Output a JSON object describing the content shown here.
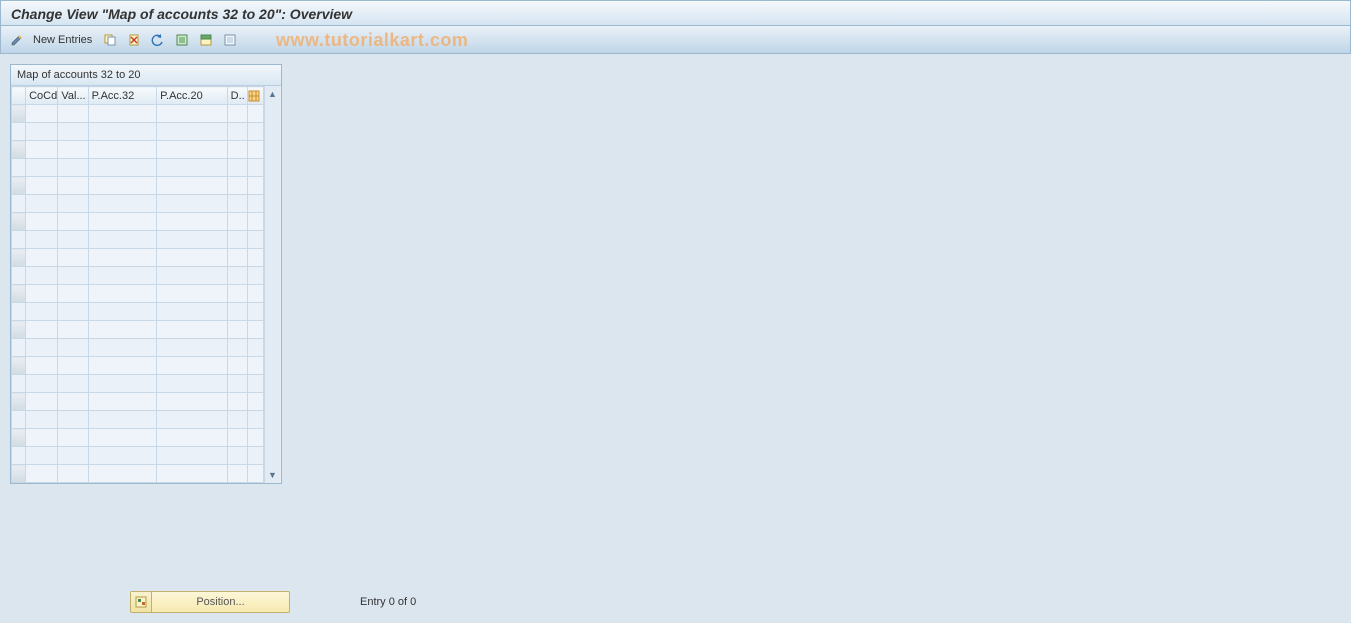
{
  "header": {
    "title": "Change View \"Map of accounts 32 to 20\": Overview"
  },
  "toolbar": {
    "new_entries_label": "New Entries",
    "icons": {
      "edit": "edit-pencil-icon",
      "copy": "copy-icon",
      "delete": "delete-icon",
      "undo": "undo-icon",
      "select_all": "select-all-icon",
      "select_block": "select-block-icon",
      "deselect_all": "deselect-all-icon"
    }
  },
  "watermark": "www.tutorialkart.com",
  "table": {
    "caption": "Map of accounts 32 to 20",
    "columns": {
      "cocd": "CoCd",
      "val": "Val...",
      "p32": "P.Acc.32",
      "p20": "P.Acc.20",
      "d": "D.."
    },
    "row_count": 21
  },
  "footer": {
    "position_label": "Position...",
    "entry_text": "Entry 0 of 0"
  }
}
